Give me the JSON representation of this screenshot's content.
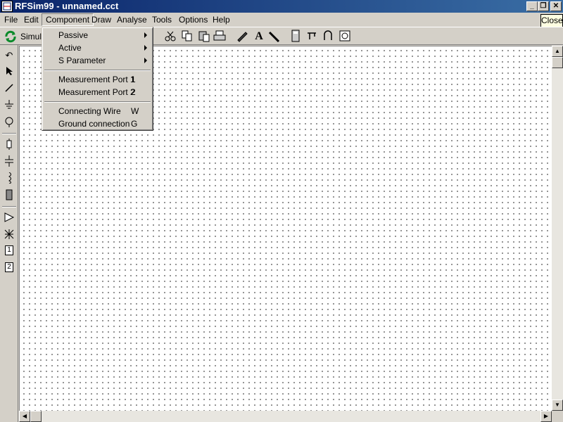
{
  "window": {
    "title": "RFSim99 - unnamed.cct",
    "minimize_glyph": "_",
    "restore_glyph": "❐",
    "close_glyph": "✕",
    "close_tooltip": "Close"
  },
  "menubar": {
    "items": [
      {
        "label": "File"
      },
      {
        "label": "Edit"
      },
      {
        "label": "Component"
      },
      {
        "label": "Draw"
      },
      {
        "label": "Analyse"
      },
      {
        "label": "Tools"
      },
      {
        "label": "Options"
      },
      {
        "label": "Help"
      }
    ]
  },
  "toolbar": {
    "simulate_label": "Simulate",
    "icons": [
      "cut-icon",
      "copy-icon",
      "paste-icon",
      "print-icon",
      "pen-icon",
      "text-icon",
      "ruler-icon",
      "calculator-icon",
      "filter-icon",
      "coupler-icon",
      "smith-icon"
    ],
    "text_tool_glyph": "A"
  },
  "palette": {
    "icons": [
      "rotate-icon",
      "pointer-icon",
      "wire-icon",
      "ground-icon",
      "port-icon",
      "resistor-icon",
      "capacitor-icon",
      "inductor-icon",
      "transformer-icon",
      "amplifier-icon",
      "transistor-icon"
    ],
    "port1_label": "1",
    "port2_label": "2"
  },
  "component_menu": {
    "items": [
      {
        "label": "Passive",
        "shortcut": "",
        "submenu": true
      },
      {
        "label": "Active",
        "shortcut": "",
        "submenu": true
      },
      {
        "label": "S Parameter",
        "shortcut": "",
        "submenu": true
      },
      {
        "label": "Measurement Port 1",
        "shortcut": "1",
        "submenu": false
      },
      {
        "label": "Measurement Port 2",
        "shortcut": "2",
        "submenu": false
      },
      {
        "label": "Connecting Wire",
        "shortcut": "W",
        "submenu": false
      },
      {
        "label": "Ground connection",
        "shortcut": "G",
        "submenu": false
      }
    ]
  }
}
